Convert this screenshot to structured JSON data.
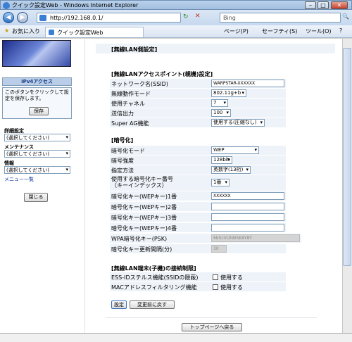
{
  "window": {
    "title": "クイック設定Web - Windows Internet Explorer",
    "min": "–",
    "max": "□",
    "close": "✕"
  },
  "address": {
    "back": "◀",
    "forward": "▶",
    "url": "http://192.168.0.1/",
    "refresh": "↻",
    "stop": "✕",
    "search_engine": "Bing",
    "search_glyph": "🔍"
  },
  "favbar": {
    "favorites": "お気に入り",
    "tab": "クイック設定Web",
    "page": "ページ(P)",
    "safety": "セーフティ(S)",
    "tools": "ツール(O)",
    "help": "?"
  },
  "sidebar": {
    "ipv4": "IPv4アクセス",
    "save_desc": "このボタンをクリックして設定を保存します。",
    "save_button": "保存",
    "detail_label": "詳細設定",
    "detail_value": "(選択してください)",
    "maint_label": "メンテナンス",
    "maint_value": "(選択してください)",
    "info_label": "情報",
    "info_value": "(選択してください)",
    "menu_list": "メニュー一覧",
    "close_button": "閉じる"
  },
  "main": {
    "page_title": "[無線LAN側設定]",
    "ap_header": "[無線LANアクセスポイント(親機)設定]",
    "ap_rows": [
      {
        "label": "ネットワーク名(SSID)",
        "value": "WARPSTAR-XXXXXX",
        "kind": "input"
      },
      {
        "label": "無線動作モード",
        "value": "802.11g+b",
        "kind": "select"
      },
      {
        "label": "使用チャネル",
        "value": "7",
        "kind": "select"
      },
      {
        "label": "送信出力",
        "value": "100",
        "kind": "select"
      },
      {
        "label": "Super AG機能",
        "value": "使用する(圧縮なし)",
        "kind": "select"
      }
    ],
    "enc_header": "[暗号化]",
    "enc_rows": [
      {
        "label": "暗号化モード",
        "value": "WEP",
        "kind": "select"
      },
      {
        "label": "暗号強度",
        "value": "128bit",
        "kind": "select"
      },
      {
        "label": "指定方法",
        "value": "英数字(13桁)",
        "kind": "select"
      },
      {
        "label": "使用する暗号化キー番号\n（キーインデックス）",
        "value": "1番",
        "kind": "select"
      },
      {
        "label": "暗号化キー(WEPキー)1番",
        "value": "XXXXXX",
        "kind": "input"
      },
      {
        "label": "暗号化キー(WEPキー)2番",
        "value": "",
        "kind": "input"
      },
      {
        "label": "暗号化キー(WEPキー)3番",
        "value": "",
        "kind": "input"
      },
      {
        "label": "暗号化キー(WEPキー)4番",
        "value": "",
        "kind": "input"
      },
      {
        "label": "WPA暗号化キー(PSK)",
        "value": "6b5cVUh8i5EAY8Y",
        "kind": "disabled"
      },
      {
        "label": "暗号化キー更新間隔(分)",
        "value": "30",
        "kind": "disabled"
      }
    ],
    "client_header": "[無線LAN端末(子機)の接続制限]",
    "client_rows": [
      {
        "label": "ESS-IDステルス機能(SSIDの隠蔽)",
        "value": "使用する"
      },
      {
        "label": "MACアドレスフィルタリング機能",
        "value": "使用する"
      }
    ],
    "set_button": "設定",
    "revert_button": "変更前に戻す",
    "top_button": "トップページへ戻る"
  }
}
